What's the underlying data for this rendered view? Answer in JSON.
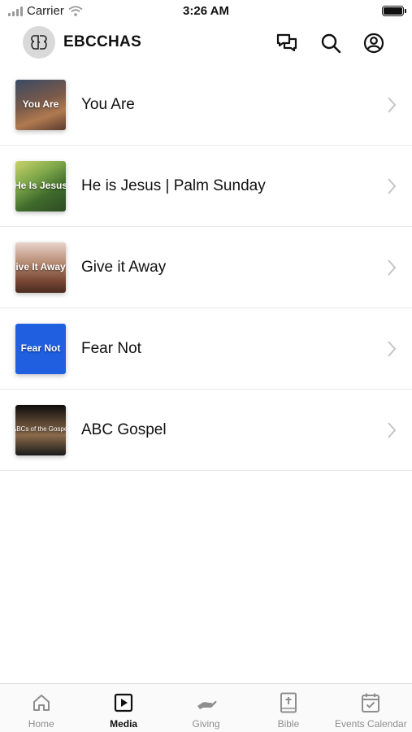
{
  "status_bar": {
    "carrier": "Carrier",
    "time": "3:26 AM"
  },
  "header": {
    "title": "EBCCHAS"
  },
  "media_items": [
    {
      "title": "You Are",
      "thumb_text": "You Are"
    },
    {
      "title": "He is Jesus | Palm Sunday",
      "thumb_text": "He Is Jesus"
    },
    {
      "title": "Give it Away",
      "thumb_text": "ive It Away"
    },
    {
      "title": "Fear Not",
      "thumb_text": "Fear Not"
    },
    {
      "title": "ABC Gospel",
      "thumb_text": "ABCs of the Gospel"
    }
  ],
  "tabs": [
    {
      "label": "Home",
      "icon": "home-icon"
    },
    {
      "label": "Media",
      "icon": "play-icon",
      "active": true
    },
    {
      "label": "Giving",
      "icon": "giving-hand-icon"
    },
    {
      "label": "Bible",
      "icon": "bible-icon"
    },
    {
      "label": "Events Calendar",
      "icon": "calendar-icon"
    }
  ],
  "colors": {
    "active_tab": "#111111",
    "inactive_tab": "#8e8e8e",
    "fear_not_thumb": "#1f5fe0"
  }
}
